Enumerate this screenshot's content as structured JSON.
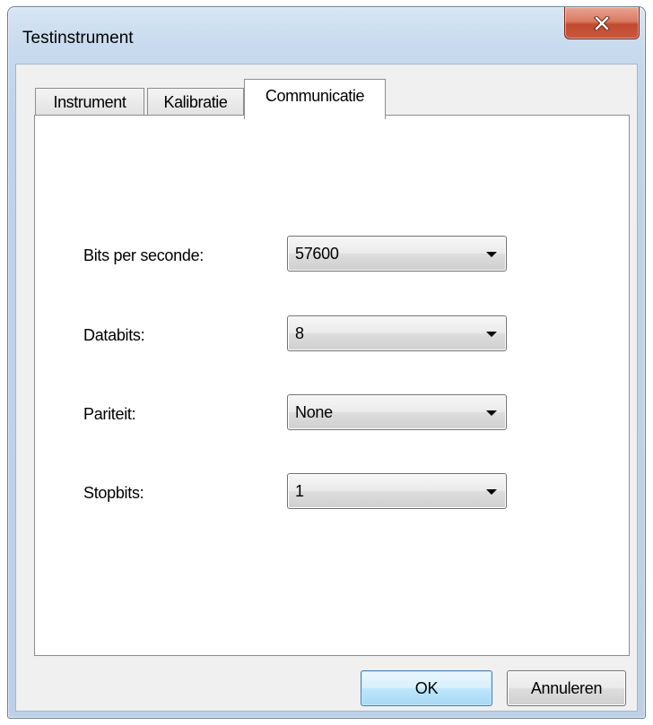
{
  "window": {
    "title": "Testinstrument",
    "close_icon": "close-icon"
  },
  "tabs": [
    {
      "label": "Instrument",
      "active": false
    },
    {
      "label": "Kalibratie",
      "active": false
    },
    {
      "label": "Communicatie",
      "active": true
    }
  ],
  "fields": [
    {
      "label": "Bits per seconde:",
      "value": "57600"
    },
    {
      "label": "Databits:",
      "value": "8"
    },
    {
      "label": "Pariteit:",
      "value": "None"
    },
    {
      "label": "Stopbits:",
      "value": "1"
    }
  ],
  "buttons": {
    "ok": "OK",
    "cancel": "Annuleren"
  },
  "colors": {
    "title_bar": "#c9dbee",
    "close_button": "#c24a2f",
    "default_button": "#bee6fd"
  }
}
